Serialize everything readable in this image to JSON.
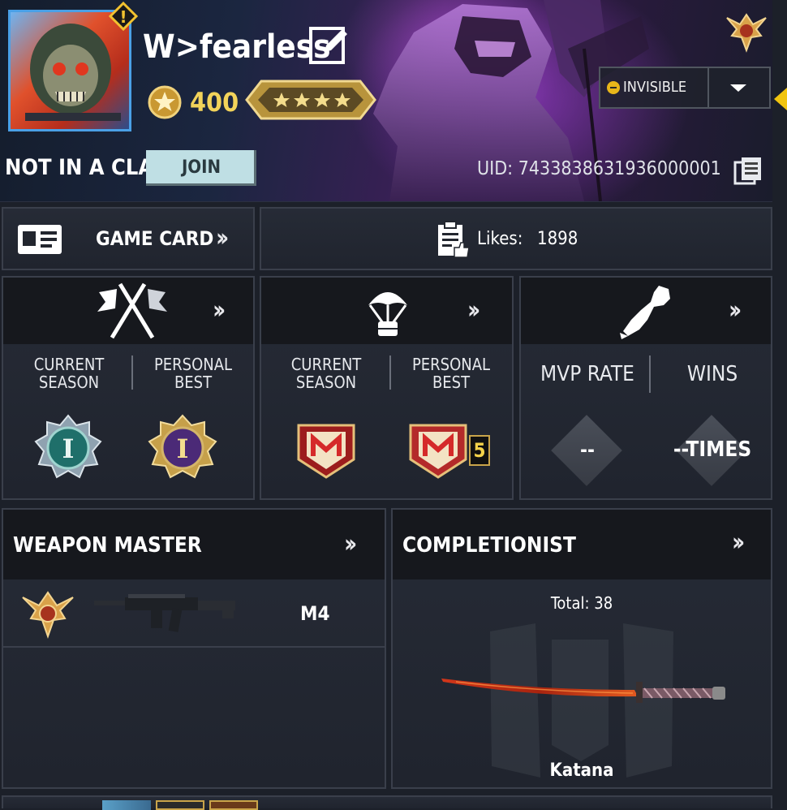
{
  "profile": {
    "username": "W>fearless",
    "credits": "400",
    "clan_status": "NOT IN A CLAN",
    "join_label": "JOIN",
    "uid": "UID: 7433838631936000001",
    "status_label": "INVISIBLE",
    "alert_icon": "alert-icon"
  },
  "nav": {
    "game_card_label": "GAME CARD",
    "likes_label": "Likes:",
    "likes_value": "1898"
  },
  "ranked_mp": {
    "current_label_1": "CURRENT",
    "current_label_2": "SEASON",
    "best_label_1": "PERSONAL",
    "best_label_2": "BEST",
    "current_tier": "I",
    "best_tier": "I"
  },
  "ranked_br": {
    "current_label_1": "CURRENT",
    "current_label_2": "SEASON",
    "best_label_1": "PERSONAL",
    "best_label_2": "BEST",
    "best_badge_count": "5"
  },
  "stats": {
    "mvp_label": "MVP RATE",
    "wins_label": "WINS",
    "mvp_value": "--",
    "wins_value": "--TIMES"
  },
  "weapon_master": {
    "title": "WEAPON MASTER",
    "weapon_name": "M4"
  },
  "completionist": {
    "title": "COMPLETIONIST",
    "total_label": "Total: 38",
    "item_name": "Katana"
  },
  "colors": {
    "accent_gold": "#e2b54a",
    "status_dot": "#e8b61a",
    "join_bg": "#bfdfe4",
    "yellow_edge": "#f1c40f"
  }
}
